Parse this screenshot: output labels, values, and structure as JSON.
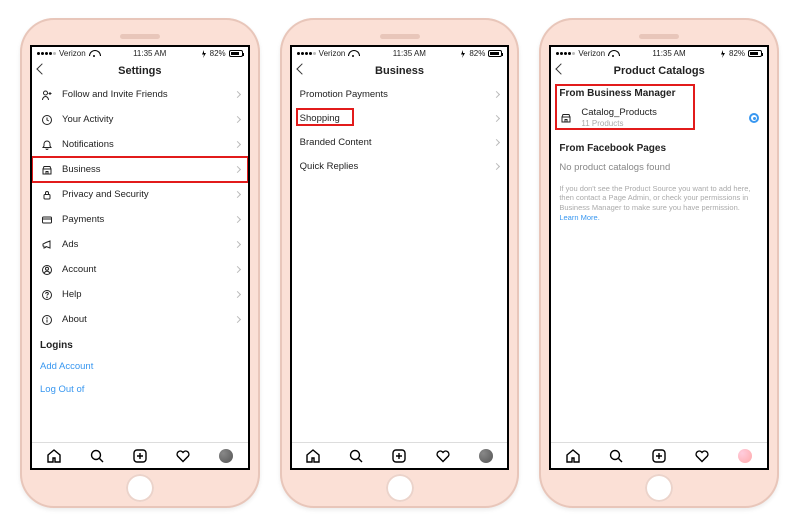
{
  "status": {
    "carrier": "Verizon",
    "time": "11:35 AM",
    "battery": "82%"
  },
  "s1": {
    "title": "Settings",
    "items": [
      {
        "icon": "person-plus",
        "label": "Follow and Invite Friends"
      },
      {
        "icon": "clock",
        "label": "Your Activity"
      },
      {
        "icon": "bell",
        "label": "Notifications"
      },
      {
        "icon": "shop",
        "label": "Business"
      },
      {
        "icon": "lock",
        "label": "Privacy and Security"
      },
      {
        "icon": "card",
        "label": "Payments"
      },
      {
        "icon": "megaphone",
        "label": "Ads"
      },
      {
        "icon": "user",
        "label": "Account"
      },
      {
        "icon": "help",
        "label": "Help"
      },
      {
        "icon": "info",
        "label": "About"
      }
    ],
    "logins_h": "Logins",
    "add": "Add Account",
    "logout": "Log Out of"
  },
  "s2": {
    "title": "Business",
    "items": [
      {
        "label": "Promotion Payments"
      },
      {
        "label": "Shopping"
      },
      {
        "label": "Branded Content"
      },
      {
        "label": "Quick Replies"
      }
    ]
  },
  "s3": {
    "title": "Product Catalogs",
    "h1": "From Business Manager",
    "cat": {
      "name": "Catalog_Products",
      "sub": "11 Products"
    },
    "h2": "From Facebook Pages",
    "empty": "No product catalogs found",
    "hint": "If you don't see the Product Source you want to add here, then contact a Page Admin, or check your permissions in Business Manager to make sure you have permission. ",
    "learn": "Learn More."
  }
}
